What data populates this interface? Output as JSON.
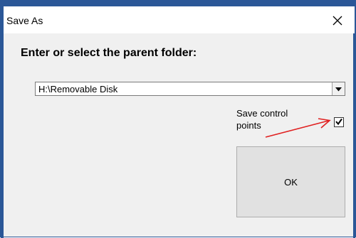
{
  "window": {
    "title": "Save As",
    "border_color": "#2b5797"
  },
  "dialog": {
    "prompt": "Enter or select the parent folder:",
    "folder_combo": {
      "selected_value": "H:\\Removable Disk"
    },
    "save_control_points": {
      "label": "Save control points",
      "checked": true
    },
    "ok_button_label": "OK",
    "annotation_arrow_color": "#e02020"
  },
  "icons": {
    "close": "close-icon",
    "dropdown": "chevron-down-icon",
    "check": "check-icon",
    "arrow": "red-arrow-annotation"
  }
}
